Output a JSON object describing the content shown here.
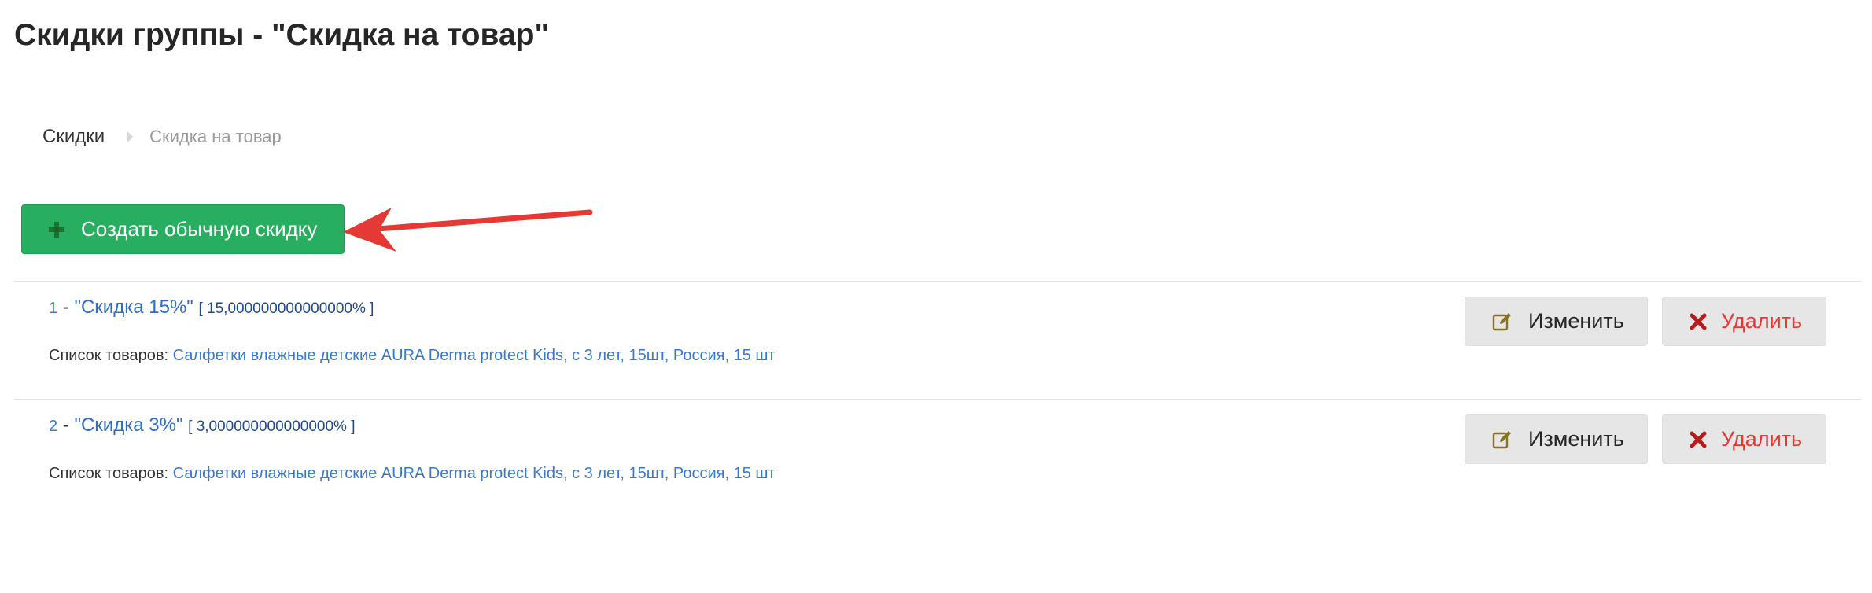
{
  "page": {
    "title": "Скидки группы - \"Скидка на товар\""
  },
  "breadcrumb": {
    "items": [
      {
        "label": "Скидки"
      },
      {
        "label": "Скидка на товар"
      }
    ]
  },
  "toolbar": {
    "create_label": "Создать обычную скидку"
  },
  "discounts": [
    {
      "number": "1",
      "separator": " - ",
      "name": "\"Скидка 15%\"",
      "value": "[ 15,000000000000000% ]",
      "products_label": "Список товаров:",
      "products": "Салфетки влажные детские AURA Derma protect Kids, с 3 лет, 15шт, Россия, 15 шт",
      "edit_label": "Изменить",
      "delete_label": "Удалить"
    },
    {
      "number": "2",
      "separator": " - ",
      "name": "\"Скидка 3%\"",
      "value": "[ 3,000000000000000% ]",
      "products_label": "Список товаров:",
      "products": "Салфетки влажные детские AURA Derma protect Kids, с 3 лет, 15шт, Россия, 15 шт",
      "edit_label": "Изменить",
      "delete_label": "Удалить"
    }
  ],
  "colors": {
    "create_button": "#27ae60",
    "link": "#3a78c9",
    "delete_text": "#e53935",
    "annotation_arrow": "#e53935"
  },
  "icons": {
    "create": "plus-icon",
    "edit": "edit-icon",
    "delete": "close-icon",
    "breadcrumb_separator": "chevron-right-icon",
    "annotation": "arrow-annotation"
  }
}
